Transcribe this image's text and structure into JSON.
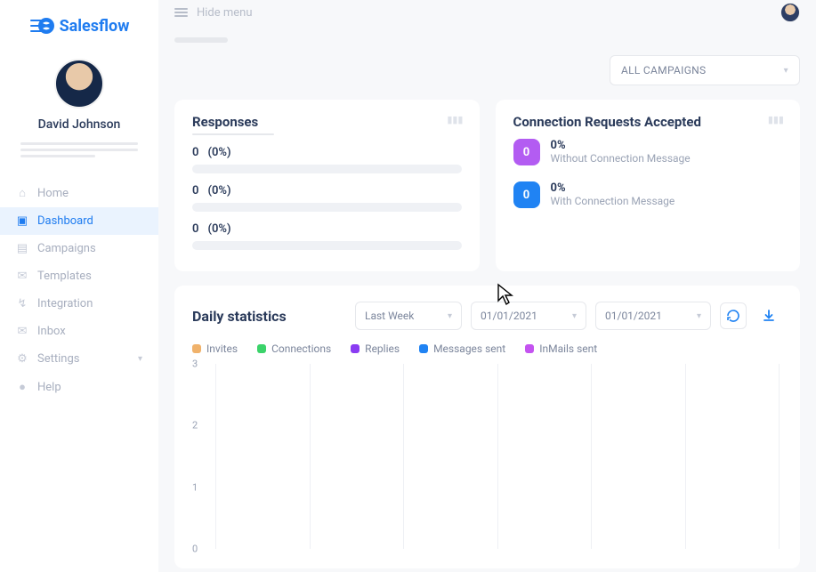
{
  "app": {
    "name": "Salesflow",
    "hide_menu_label": "Hide menu"
  },
  "user": {
    "name": "David Johnson"
  },
  "nav": {
    "items": [
      {
        "icon": "home",
        "label": "Home"
      },
      {
        "icon": "dashboard",
        "label": "Dashboard",
        "active": true
      },
      {
        "icon": "campaigns",
        "label": "Campaigns"
      },
      {
        "icon": "templates",
        "label": "Templates"
      },
      {
        "icon": "integration",
        "label": "Integration"
      },
      {
        "icon": "inbox",
        "label": "Inbox"
      },
      {
        "icon": "settings",
        "label": "Settings",
        "has_caret": true
      },
      {
        "icon": "help",
        "label": "Help"
      }
    ]
  },
  "campaign_filter": {
    "label": "ALL CAMPAIGNS"
  },
  "responses": {
    "title": "Responses",
    "rows": [
      {
        "count": "0",
        "pct": "(0%)"
      },
      {
        "count": "0",
        "pct": "(0%)"
      },
      {
        "count": "0",
        "pct": "(0%)"
      }
    ]
  },
  "connections": {
    "title": "Connection Requests Accepted",
    "rows": [
      {
        "badge": "0",
        "color": "purple",
        "pct": "0%",
        "desc": "Without Connection Message"
      },
      {
        "badge": "0",
        "color": "blue",
        "pct": "0%",
        "desc": "With Connection Message"
      }
    ]
  },
  "stats": {
    "title": "Daily statistics",
    "range_label": "Last Week",
    "date_from": "01/01/2021",
    "date_to": "01/01/2021",
    "legend": [
      {
        "label": "Invites",
        "color": "#f0b26b"
      },
      {
        "label": "Connections",
        "color": "#3bd36a"
      },
      {
        "label": "Replies",
        "color": "#8a3cf2"
      },
      {
        "label": "Messages sent",
        "color": "#2083f3"
      },
      {
        "label": "InMails sent",
        "color": "#c453f0"
      }
    ]
  },
  "chart_data": {
    "type": "line",
    "categories": [
      "",
      "",
      "",
      "",
      "",
      "",
      ""
    ],
    "series": [
      {
        "name": "Invites",
        "values": [
          0,
          0,
          0,
          0,
          0,
          0,
          0
        ]
      },
      {
        "name": "Connections",
        "values": [
          0,
          0,
          0,
          0,
          0,
          0,
          0
        ]
      },
      {
        "name": "Replies",
        "values": [
          0,
          0,
          0,
          0,
          0,
          0,
          0
        ]
      },
      {
        "name": "Messages sent",
        "values": [
          0,
          0,
          0,
          0,
          0,
          0,
          0
        ]
      },
      {
        "name": "InMails sent",
        "values": [
          0,
          0,
          0,
          0,
          0,
          0,
          0
        ]
      }
    ],
    "y_ticks": [
      3,
      2,
      1,
      0
    ],
    "ylim": [
      0,
      3
    ],
    "xlabel": "",
    "ylabel": "",
    "title": ""
  },
  "colors": {
    "accent": "#1f7cf0"
  }
}
